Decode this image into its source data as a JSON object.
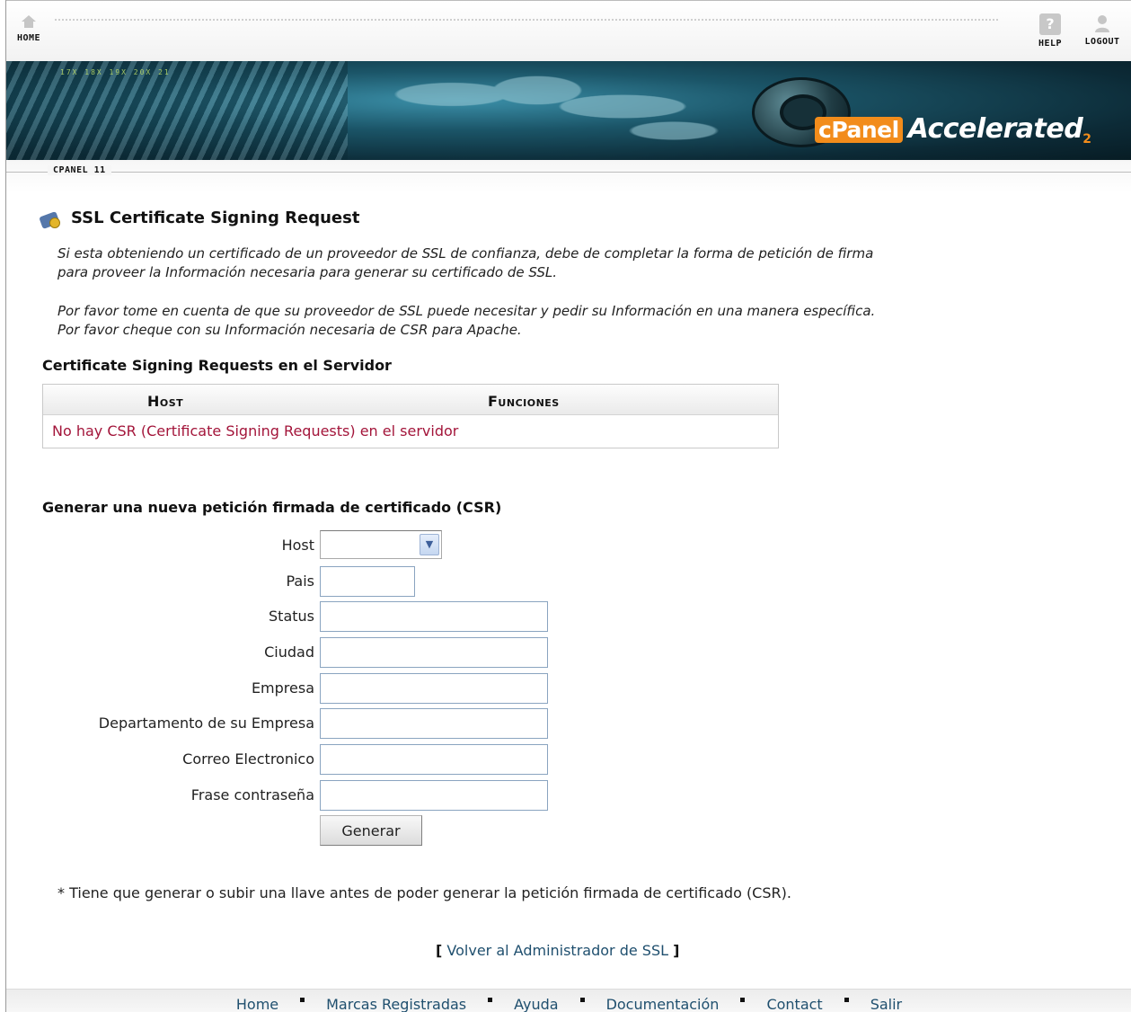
{
  "topnav": {
    "home_label": "HOME",
    "help_label": "HELP",
    "logout_label": "LOGOUT",
    "help_glyph": "?"
  },
  "banner": {
    "numbers": "17X   18X   19X   20X   21",
    "logo_cpanel": "cPanel",
    "logo_accelerated": "Accelerated",
    "logo_version": "2"
  },
  "strip": {
    "label": "CPANEL 11"
  },
  "page": {
    "title": "SSL Certificate Signing Request",
    "intro_1a": "Si esta obteniendo un certificado de un proveedor de SSL de confianza, debe de completar la forma de petición de firma",
    "intro_1b": "para proveer la Información necesaria para generar su certificado de SSL.",
    "intro_2a": "Por favor tome en cuenta de que su proveedor de SSL puede necesitar y pedir su Información en una manera específica.",
    "intro_2b": "Por favor cheque con su Información necesaria de CSR para Apache."
  },
  "csr_list": {
    "title": "Certificate Signing Requests en el Servidor",
    "columns": [
      "Host",
      "Funciones"
    ],
    "empty_message": "No hay CSR (Certificate Signing Requests) en el servidor"
  },
  "form": {
    "title": "Generar una nueva petición firmada de certificado (CSR)",
    "fields": [
      {
        "label": "Host",
        "value": ""
      },
      {
        "label": "Pais",
        "value": ""
      },
      {
        "label": "Status",
        "value": ""
      },
      {
        "label": "Ciudad",
        "value": ""
      },
      {
        "label": "Empresa",
        "value": ""
      },
      {
        "label": "Departamento de su Empresa",
        "value": ""
      },
      {
        "label": "Correo Electronico",
        "value": ""
      },
      {
        "label": "Frase contraseña",
        "value": ""
      }
    ],
    "submit_label": "Generar",
    "note": "* Tiene que generar o subir una llave antes de poder generar la petición firmada de certificado (CSR)."
  },
  "back_link": {
    "open_bracket": "[",
    "label": "Volver al Administrador de SSL",
    "close_bracket": "]"
  },
  "footer": {
    "links": [
      "Home",
      "Marcas Registradas",
      "Ayuda",
      "Documentación",
      "Contact",
      "Salir"
    ]
  }
}
